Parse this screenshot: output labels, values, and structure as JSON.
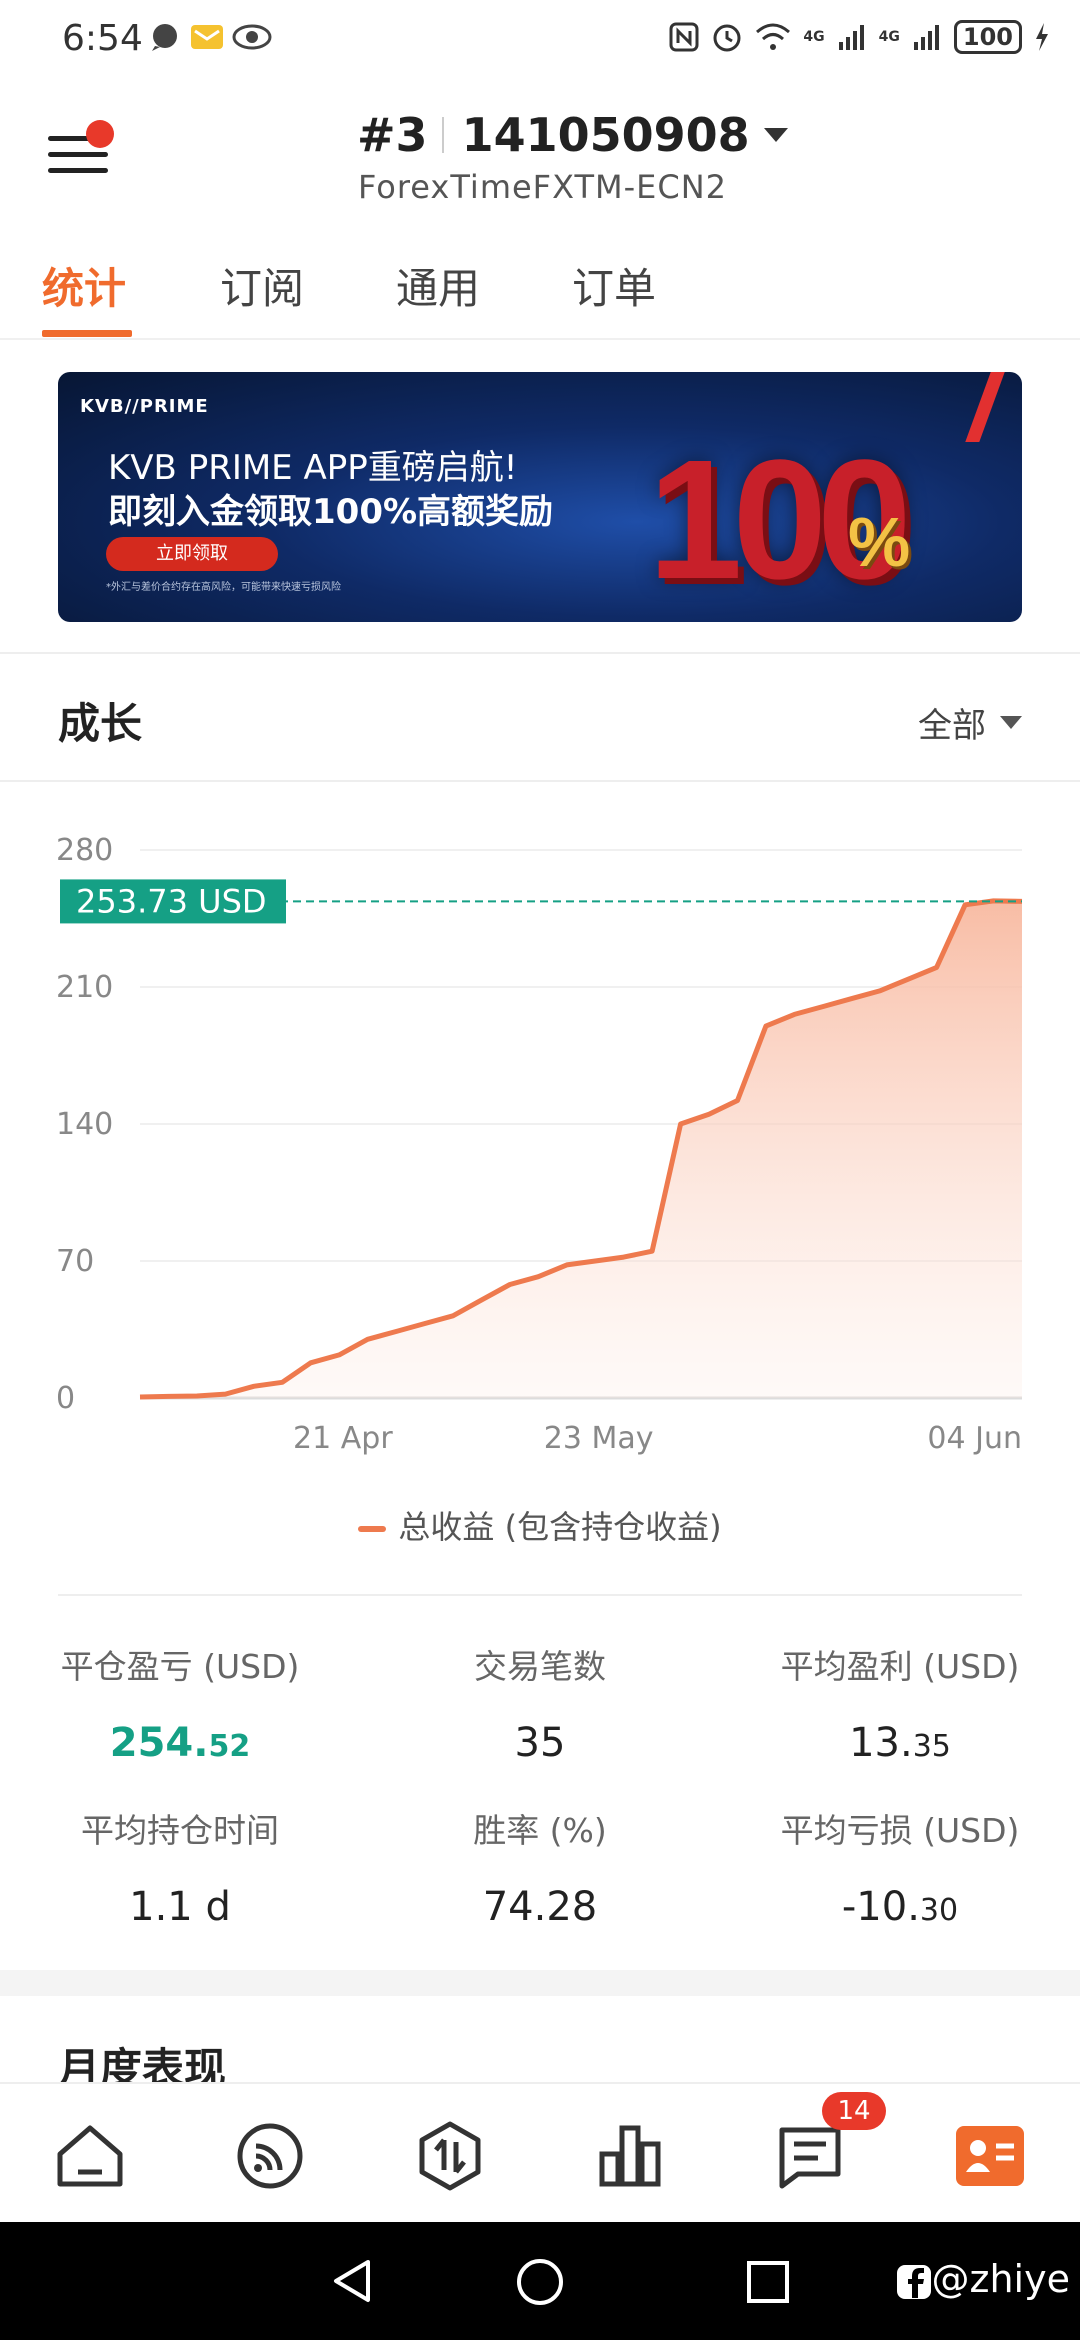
{
  "status_bar": {
    "time": "6:54",
    "battery": "100",
    "network_1": "4G",
    "network_2": "4G"
  },
  "header": {
    "account_index": "#3",
    "account_number": "141050908",
    "broker": "ForexTimeFXTM-ECN2"
  },
  "tabs": [
    {
      "label": "统计",
      "active": true
    },
    {
      "label": "订阅",
      "active": false
    },
    {
      "label": "通用",
      "active": false
    },
    {
      "label": "订单",
      "active": false
    }
  ],
  "banner": {
    "logo": "KVB//PRIME",
    "line1": "KVB PRIME APP重磅启航!",
    "line2": "即刻入金领取100%高额奖励",
    "button": "立即领取",
    "note": "*外汇与差价合约存在高风险，可能带来快速亏损风险",
    "big_number": "100",
    "percent": "%"
  },
  "growth": {
    "title": "成长",
    "range": "全部"
  },
  "chart_data": {
    "type": "area",
    "current_value_label": "253.73 USD",
    "current_value": 253.73,
    "ylim": [
      0,
      280
    ],
    "y_ticks": [
      "0",
      "70",
      "140",
      "210",
      "280"
    ],
    "x_tick_labels": [
      "21 Apr",
      "23 May",
      "04 Jun"
    ],
    "series": [
      {
        "name": "总收益 (包含持仓收益)",
        "values": [
          0.5,
          0.8,
          1,
          2,
          6,
          8,
          18,
          22,
          30,
          34,
          38,
          42,
          50,
          58,
          62,
          68,
          70,
          72,
          75,
          140,
          145,
          152,
          190,
          196,
          200,
          204,
          208,
          214,
          220,
          252,
          254,
          253.73
        ]
      }
    ],
    "colors": {
      "line": "#ee7a4e",
      "fill_top": "#f8b9a0",
      "ref_line": "#15a085",
      "label_bg": "#15a085"
    }
  },
  "stats": [
    {
      "label": "平仓盈亏 (USD)",
      "int": "254.",
      "dec": "52",
      "highlight": true
    },
    {
      "label": "交易笔数",
      "int": "35",
      "dec": "",
      "highlight": false
    },
    {
      "label": "平均盈利 (USD)",
      "int": "13.",
      "dec": "35",
      "highlight": false
    },
    {
      "label": "平均持仓时间",
      "int": "1.1 d",
      "dec": "",
      "highlight": false
    },
    {
      "label": "胜率 (%)",
      "int": "74.28",
      "dec": "",
      "highlight": false
    },
    {
      "label": "平均亏损 (USD)",
      "int": "-10.",
      "dec": "30",
      "highlight": false
    }
  ],
  "monthly": {
    "title": "月度表现"
  },
  "bottom_nav": {
    "items": [
      "home-icon",
      "feed-icon",
      "trade-icon",
      "chart-icon",
      "messages-icon",
      "profile-icon"
    ],
    "badge": "14"
  },
  "watermark": "@zhiye"
}
